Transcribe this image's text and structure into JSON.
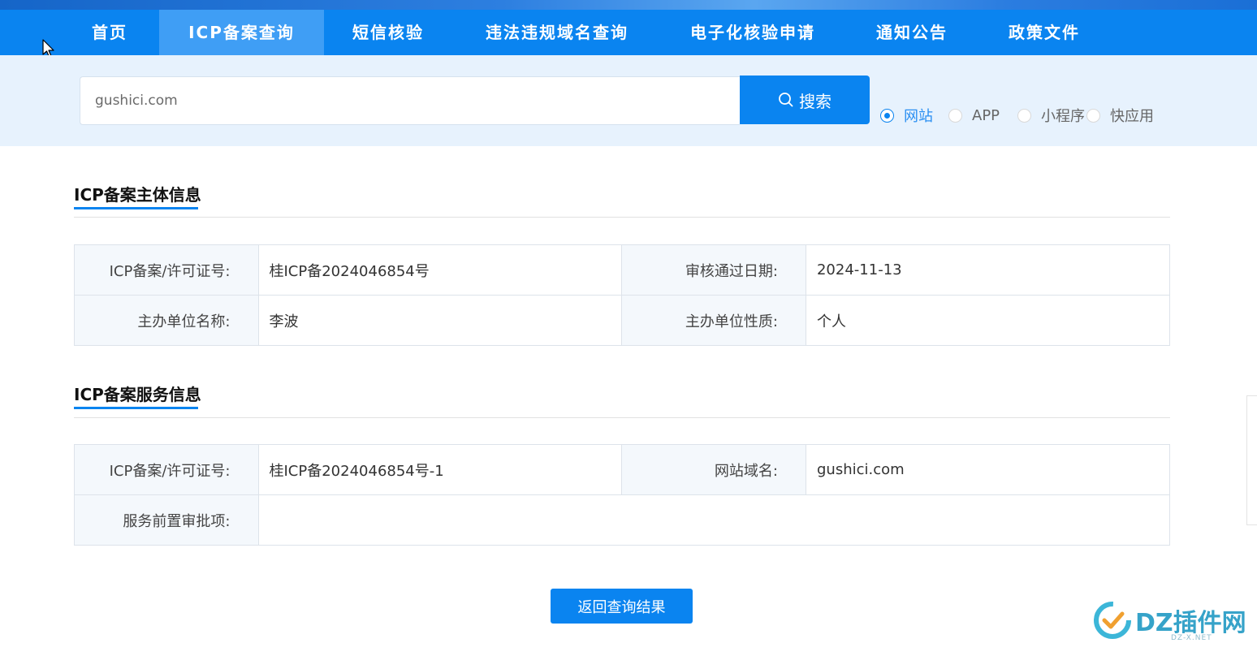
{
  "nav": {
    "items": [
      {
        "label": "首页"
      },
      {
        "label": "ICP备案查询"
      },
      {
        "label": "短信核验"
      },
      {
        "label": "违法违规域名查询"
      },
      {
        "label": "电子化核验申请"
      },
      {
        "label": "通知公告"
      },
      {
        "label": "政策文件"
      }
    ],
    "active_index": 1
  },
  "search": {
    "value": "gushici.com",
    "button_label": "搜索",
    "types": [
      {
        "label": "网站",
        "checked": true
      },
      {
        "label": "APP",
        "checked": false
      },
      {
        "label": "小程序",
        "checked": false
      },
      {
        "label": "快应用",
        "checked": false
      }
    ]
  },
  "subject": {
    "title": "ICP备案主体信息",
    "license_label": "ICP备案/许可证号:",
    "license_value": "桂ICP备2024046854号",
    "date_label": "审核通过日期:",
    "date_value": "2024-11-13",
    "org_label": "主办单位名称:",
    "org_value": "李波",
    "nature_label": "主办单位性质:",
    "nature_value": "个人"
  },
  "service": {
    "title": "ICP备案服务信息",
    "license_label": "ICP备案/许可证号:",
    "license_value": "桂ICP备2024046854号-1",
    "domain_label": "网站域名:",
    "domain_value": "gushici.com",
    "approval_label": "服务前置审批项:",
    "approval_value": ""
  },
  "back_button": "返回查询结果",
  "watermark": {
    "text": "DZ插件网",
    "sub": "DZ-X.NET"
  },
  "colors": {
    "primary": "#0a84f0",
    "nav_active": "#3f9ef5",
    "search_band": "#e7f2fd",
    "label_cell": "#f4f8fc"
  }
}
